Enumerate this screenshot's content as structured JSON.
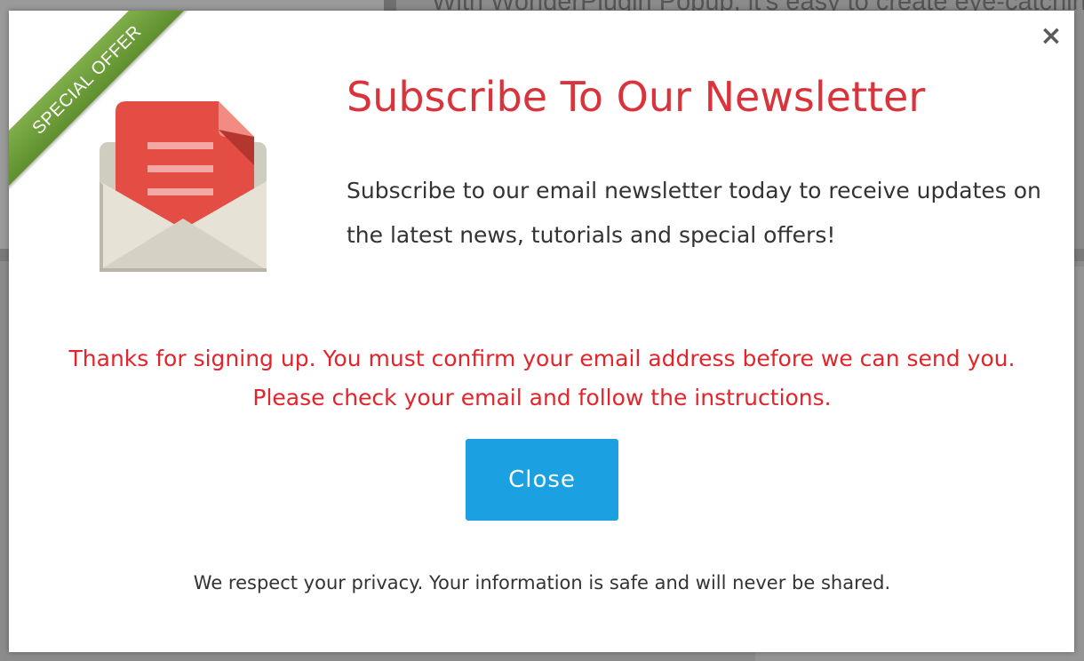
{
  "background": {
    "top_text": "With WonderPlugin Popup, it's easy to create eye-catching"
  },
  "popup": {
    "ribbon_label": "SPECIAL OFFER",
    "close_icon": "×",
    "title": "Subscribe To Our Newsletter",
    "description": "Subscribe to our email newsletter today to receive updates on the latest news, tutorials and special offers!",
    "confirmation_message": "Thanks for signing up. You must confirm your email address before we can send you. Please check your email and follow the instructions.",
    "close_button_label": "Close",
    "privacy_note": "We respect your privacy. Your information is safe and will never be shared."
  },
  "colors": {
    "title": "#d9333b",
    "message": "#e3242b",
    "button": "#1ba1e2",
    "ribbon": "#6f9f3c"
  },
  "icons": {
    "envelope": "envelope-icon",
    "close": "close-icon"
  }
}
